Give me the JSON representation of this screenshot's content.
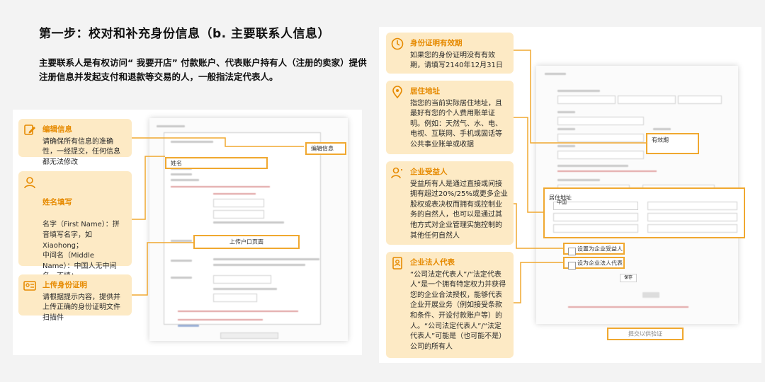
{
  "header": {
    "title": "第一步：校对和补充身份信息（b. 主要联系人信息）",
    "intro": "主要联系人是有权访问“ 我要开店” 付款账户、代表账户持有人（注册的卖家）提供注册信息并发起支付和退款等交易的人，一般指法定代表人。"
  },
  "left_annotations": [
    {
      "icon": "edit-icon",
      "title": "编辑信息",
      "body": "请确保所有信息的准确性，一经提交，任何信息都无法修改"
    },
    {
      "icon": "person-icon",
      "title": "姓名填写",
      "body": "名字（First Name）：拼音填写名字，如 Xiaohong；\n中间名（Middle Name）：中国人无中间名，不填；\n姓氏（Surname(s)）：拼音填写姓，如Zhang。（确保拼音拼写正确）"
    },
    {
      "icon": "id-card-icon",
      "title": "上传身份证明",
      "body": "请根据提示内容，提供并上传正确的身份证明文件扫描件"
    }
  ],
  "right_annotations": [
    {
      "icon": "clock-icon",
      "title": "身份证明有效期",
      "body": "如果您的身份证明没有有效期，请填写2140年12月31日"
    },
    {
      "icon": "location-icon",
      "title": "居住地址",
      "body": "指您的当前实际居住地址，且最好有您的个人费用账单证明。例如：天然气、水、电、电视、互联网、手机或固话等公共事业账单或收据"
    },
    {
      "icon": "beneficiary-icon",
      "title": "企业受益人",
      "body": "受益所有人是通过直接或间接拥有超过20%/25%或更多企业股权或表决权而拥有或控制业务的自然人，也可以是通过其他方式对企业管理实施控制的其他任何自然人"
    },
    {
      "icon": "legal-rep-icon",
      "title": "企业法人代表",
      "body": "“公司法定代表人”/“法定代表人”是一个拥有特定权力并获得您的企业合法授权，能够代表企业开展业务（例如接受条款和条件、开设付款账户等）的人。“公司法定代表人”/“法定代表人”可能是（也可能不是）公司的所有人"
    }
  ],
  "left_form": {
    "edit_button": "编辑信息",
    "name_label": "姓名",
    "upload_button": "上传户口页面",
    "footer_note": "* Epyoders are not allowed to submit KYC information"
  },
  "right_form": {
    "expiry_label": "有效期",
    "address_label": "居住地址",
    "country_value": "中国",
    "beneficiary_checkbox": "设置为企业受益人",
    "legal_rep_checkbox": "设为企业法人代表",
    "save_button": "保存",
    "submit_button": "提交以供验证",
    "footer_note": "* Epyoders are not allowed to submit KYC information"
  },
  "colors": {
    "accent": "#f0a830",
    "annotation_bg": "#fdeac5",
    "title_orange": "#e68a00"
  }
}
